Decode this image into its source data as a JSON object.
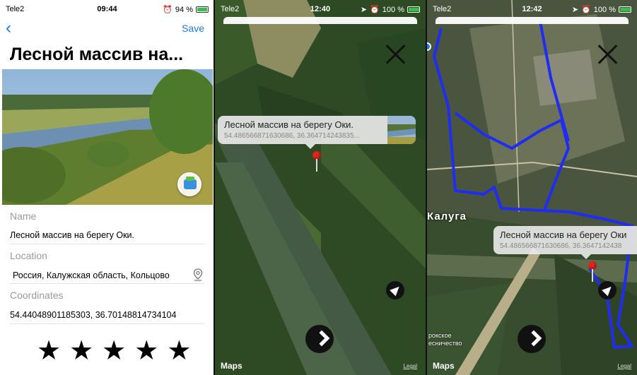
{
  "screen1": {
    "status": {
      "carrier": "Tele2",
      "time": "09:44",
      "battery": "94 %"
    },
    "nav": {
      "back_icon": "chevron-left-icon",
      "save_label": "Save"
    },
    "title": "Лесной массив на...",
    "fields": {
      "name_label": "Name",
      "name_value": "Лесной массив на берегу Оки.",
      "location_label": "Location",
      "location_value": "Россия, Калужская область, Кольцово",
      "coordinates_label": "Coordinates",
      "coordinates_value": "54.44048901185303, 36.70148814734104"
    },
    "rating": {
      "stars": 5,
      "glyph": "★"
    }
  },
  "screen2": {
    "status": {
      "carrier": "Tele2",
      "time": "12:40",
      "battery": "100 %"
    },
    "callout": {
      "title": "Лесной массив на берегу Оки.",
      "subtitle": "54.486566871630686, 36.364714243835..."
    },
    "maps_label": "Maps",
    "legal_label": "Legal"
  },
  "screen3": {
    "status": {
      "carrier": "Tele2",
      "time": "12:42",
      "battery": "100 %"
    },
    "callout": {
      "title": "Лесной массив на берегу Оки",
      "subtitle": "54.486566871630686, 36.3647142438"
    },
    "city_label": "Калуга",
    "forestry_label_1": "рокское",
    "forestry_label_2": "есничество",
    "maps_label": "Maps",
    "legal_label": "Legal"
  },
  "colors": {
    "accent": "#1a7bf0",
    "route": "#1f2cf2",
    "pin": "#e0261c"
  }
}
